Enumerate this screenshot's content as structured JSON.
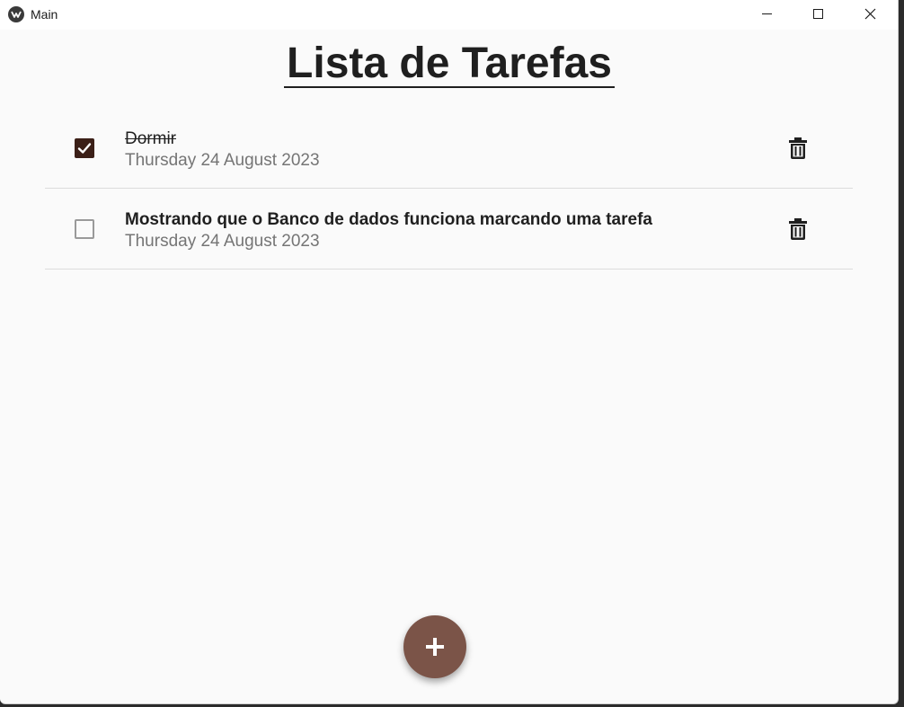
{
  "window": {
    "title": "Main",
    "app_icon": "kivy-logo-icon",
    "controls": [
      "minimize-icon",
      "maximize-icon",
      "close-icon"
    ]
  },
  "page": {
    "title": " Lista de Tarefas"
  },
  "tasks": [
    {
      "text": "Dormir",
      "date": "Thursday 24 August 2023",
      "checked": true
    },
    {
      "text": "Mostrando que o Banco de dados funciona marcando uma tarefa",
      "date": "Thursday 24 August 2023",
      "checked": false
    }
  ],
  "fab": {
    "icon": "plus-icon"
  },
  "colors": {
    "accent": "#7b5448",
    "checkbox_checked": "#3b1f17",
    "background": "#fafafa",
    "date_text": "#757575"
  }
}
